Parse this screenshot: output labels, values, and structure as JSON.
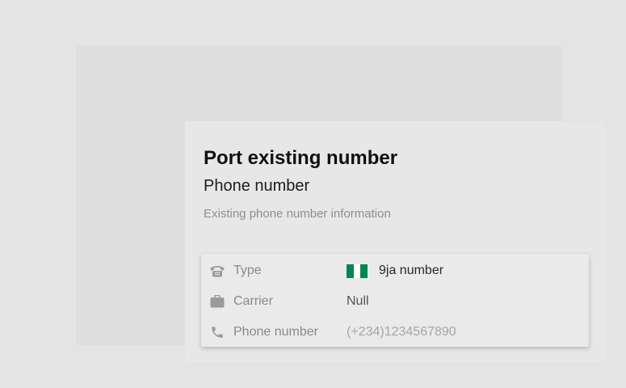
{
  "dialog": {
    "title": "Port existing number",
    "subtitle": "Phone number",
    "description": "Existing phone number information"
  },
  "info": {
    "rows": [
      {
        "icon": "telephone-icon",
        "label": "Type",
        "value": "9ja number",
        "flag": "nigeria-flag"
      },
      {
        "icon": "briefcase-icon",
        "label": "Carrier",
        "value": "Null"
      },
      {
        "icon": "phone-handset-icon",
        "label": "Phone number",
        "value": "(+234)1234567890"
      }
    ]
  },
  "colors": {
    "page_background": "#e4e4e4",
    "icon_gray": "#9a9a9a",
    "flag_green": "#008751",
    "flag_white": "#ffffff"
  }
}
